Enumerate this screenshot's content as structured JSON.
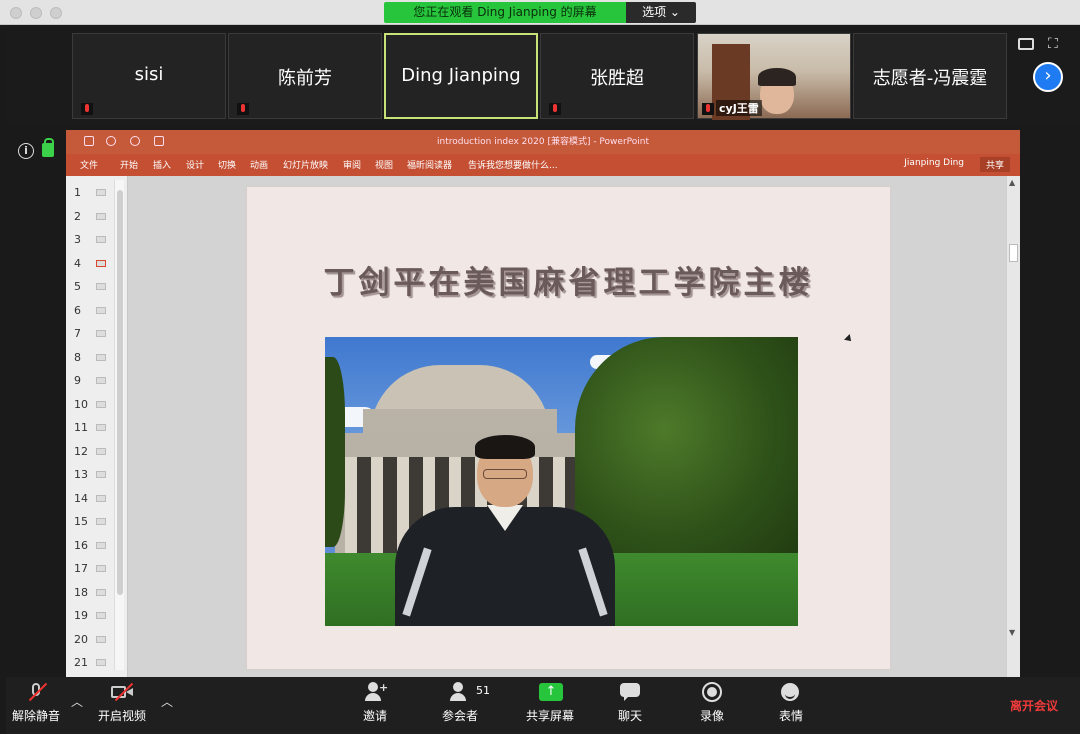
{
  "banner": {
    "viewing_text": "您正在观看 Ding Jianping 的屏幕",
    "options_label": "选项 ⌄"
  },
  "participants": [
    {
      "name": "sisi"
    },
    {
      "name": "陈前芳"
    },
    {
      "name": "Ding Jianping"
    },
    {
      "name": "张胜超"
    },
    {
      "name": "cyJ王雷"
    },
    {
      "name": "志愿者-冯震霆"
    }
  ],
  "ppt": {
    "window_title": "introduction index 2020 [兼容模式] - PowerPoint",
    "tabs": [
      "文件",
      "开始",
      "插入",
      "设计",
      "切换",
      "动画",
      "幻灯片放映",
      "审阅",
      "视图",
      "福昕阅读器",
      "告诉我您想要做什么..."
    ],
    "user": "Jianping Ding",
    "share": "共享",
    "thumbnails": [
      "1",
      "2",
      "3",
      "4",
      "5",
      "6",
      "7",
      "8",
      "9",
      "10",
      "11",
      "12",
      "13",
      "14",
      "15",
      "16",
      "17",
      "18",
      "19",
      "20",
      "21"
    ],
    "selected_slide": "4",
    "slide_heading": "丁剑平在美国麻省理工学院主楼"
  },
  "toolbar": {
    "unmute": "解除静音",
    "start_video": "开启视频",
    "invite": "邀请",
    "participants": "参会者",
    "participant_count": "51",
    "share_screen": "共享屏幕",
    "chat": "聊天",
    "record": "录像",
    "reactions": "表情",
    "leave": "离开会议"
  }
}
